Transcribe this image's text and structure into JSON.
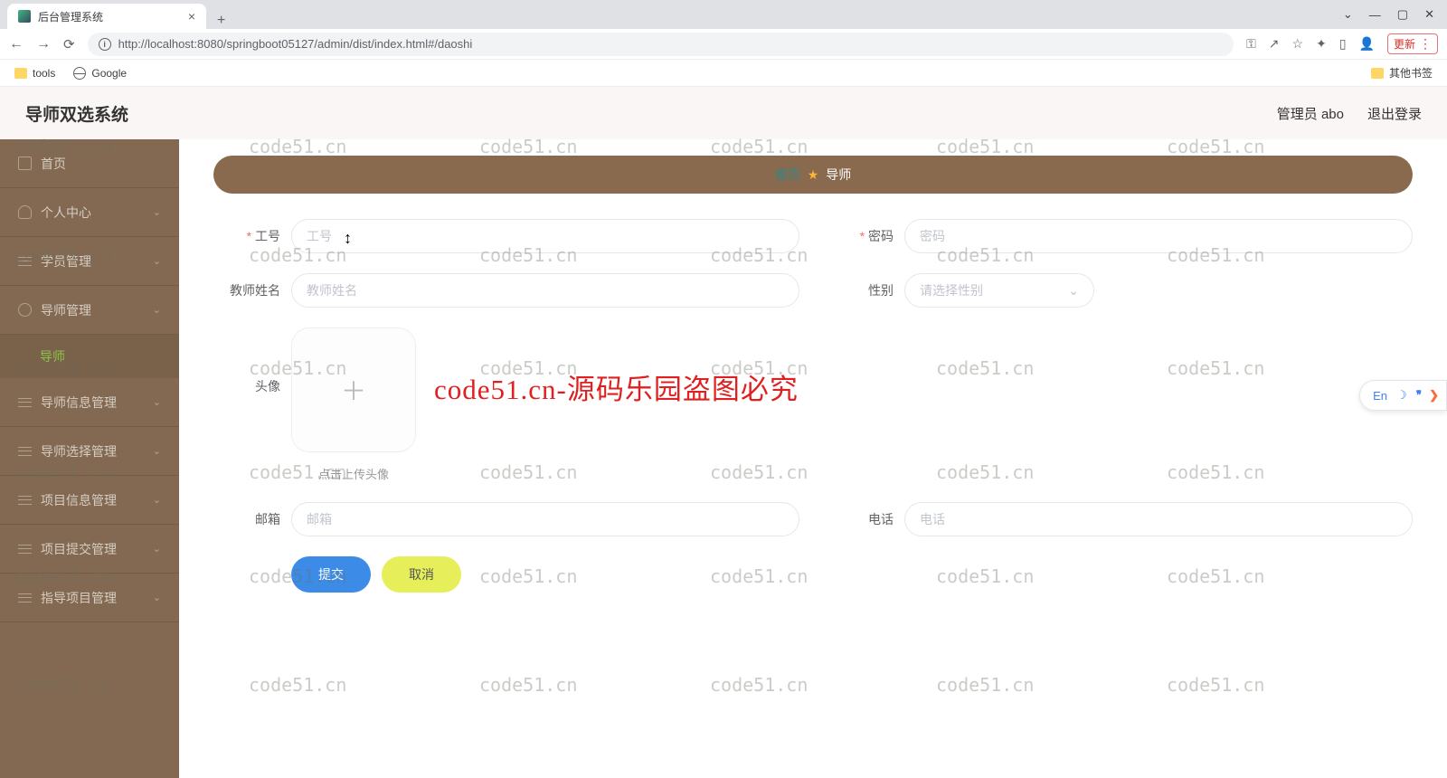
{
  "browser": {
    "tab_title": "后台管理系统",
    "url": "http://localhost:8080/springboot05127/admin/dist/index.html#/daoshi",
    "bookmarks": {
      "tools": "tools",
      "google": "Google",
      "other": "其他书签"
    },
    "update_label": "更新"
  },
  "header": {
    "app_title": "导师双选系统",
    "user_text": "管理员 abo",
    "logout": "退出登录"
  },
  "sidebar": {
    "items": [
      {
        "label": "首页"
      },
      {
        "label": "个人中心"
      },
      {
        "label": "学员管理"
      },
      {
        "label": "导师管理"
      },
      {
        "label": "导师信息管理"
      },
      {
        "label": "导师选择管理"
      },
      {
        "label": "项目信息管理"
      },
      {
        "label": "项目提交管理"
      },
      {
        "label": "指导项目管理"
      }
    ],
    "submenu_active": "导师"
  },
  "breadcrumb": {
    "home": "首页",
    "current": "导师"
  },
  "form": {
    "gonghao": {
      "label": "工号",
      "placeholder": "工号"
    },
    "mima": {
      "label": "密码",
      "placeholder": "密码"
    },
    "jiaoshi": {
      "label": "教师姓名",
      "placeholder": "教师姓名"
    },
    "xingbie": {
      "label": "性别",
      "placeholder": "请选择性别"
    },
    "touxiang": {
      "label": "头像",
      "hint": "点击上传头像"
    },
    "youxiang": {
      "label": "邮箱",
      "placeholder": "邮箱"
    },
    "dianhua": {
      "label": "电话",
      "placeholder": "电话"
    },
    "submit": "提交",
    "cancel": "取消"
  },
  "watermark": {
    "text": "code51.cn",
    "big": "code51.cn-源码乐园盗图必究"
  },
  "widget": {
    "en": "En"
  }
}
